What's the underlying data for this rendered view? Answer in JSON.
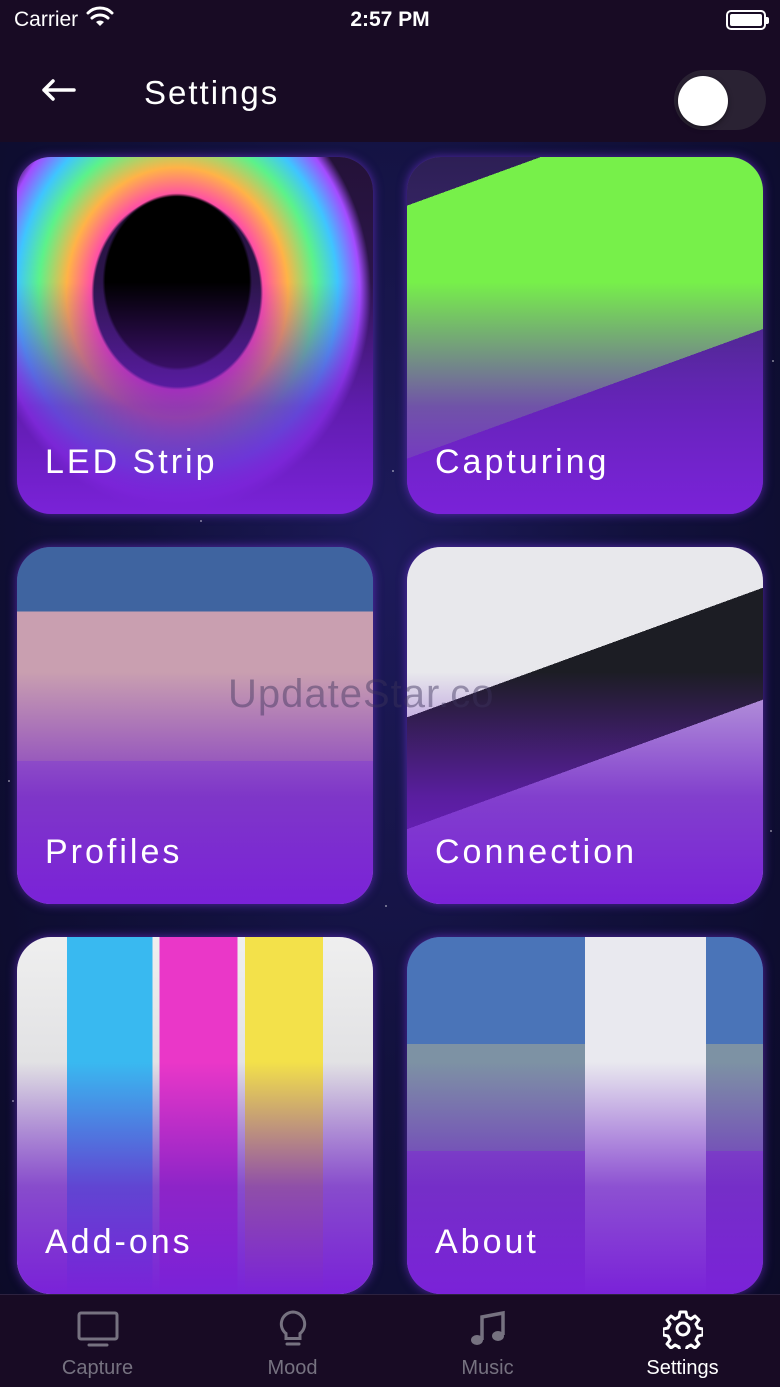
{
  "status_bar": {
    "carrier": "Carrier",
    "time": "2:57 PM"
  },
  "header": {
    "title": "Settings",
    "toggle_on": false
  },
  "tiles": [
    {
      "label": "LED Strip"
    },
    {
      "label": "Capturing"
    },
    {
      "label": "Profiles"
    },
    {
      "label": "Connection"
    },
    {
      "label": "Add-ons"
    },
    {
      "label": "About"
    }
  ],
  "watermark": "UpdateStar.co",
  "tabbar": {
    "items": [
      {
        "label": "Capture",
        "icon": "monitor-icon",
        "active": false
      },
      {
        "label": "Mood",
        "icon": "lightbulb-icon",
        "active": false
      },
      {
        "label": "Music",
        "icon": "music-note-icon",
        "active": false
      },
      {
        "label": "Settings",
        "icon": "gear-icon",
        "active": true
      }
    ]
  },
  "colors": {
    "accent": "#7a22d8",
    "bar_bg": "#180b24",
    "inactive": "#767280"
  }
}
